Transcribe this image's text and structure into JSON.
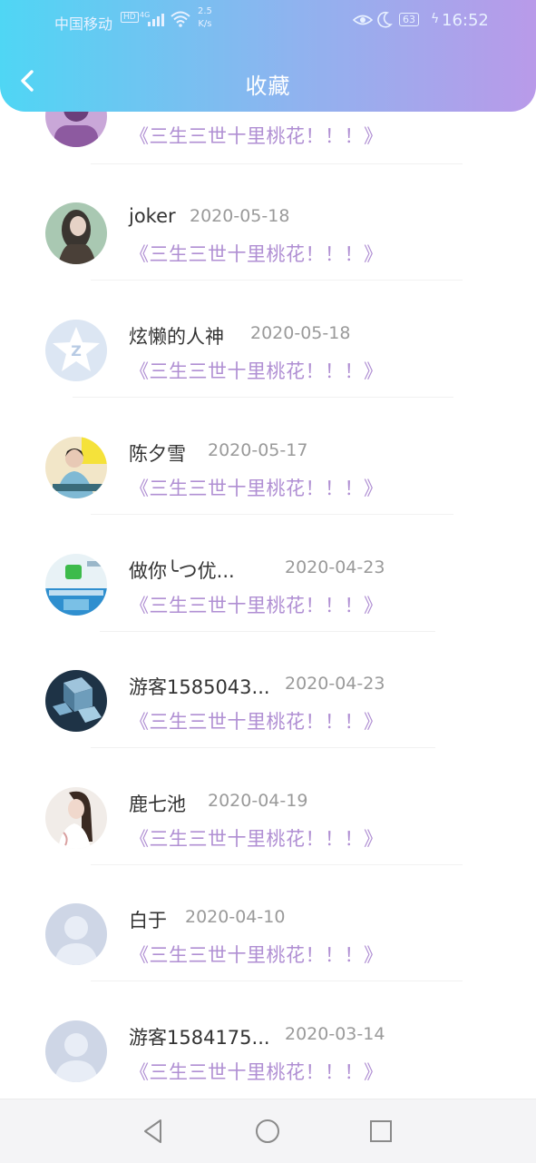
{
  "status_bar": {
    "carrier": "中国移动",
    "hd": "HD",
    "signal": "4G",
    "speed_value": "2.5",
    "speed_unit": "K/s",
    "battery": "63",
    "time": "16:52"
  },
  "header": {
    "title": "收藏",
    "back_icon": "chevron-left-icon"
  },
  "favorites": [
    {
      "name": "",
      "date": "",
      "content": "《三生三世十里桃花！！！》",
      "avatar": "purple-portrait"
    },
    {
      "name": "joker",
      "date": "2020-05-18",
      "content": "《三生三世十里桃花！！！》",
      "avatar": "long-hair-girl-photo"
    },
    {
      "name": "炫懒的人神",
      "date": "2020-05-18",
      "content": "《三生三世十里桃花！！！》",
      "avatar": "qzone-star-default"
    },
    {
      "name": "陈夕雪",
      "date": "2020-05-17",
      "content": "《三生三世十里桃花！！！》",
      "avatar": "costume-girl-photo"
    },
    {
      "name": "做你╰つ优...",
      "date": "2020-04-23",
      "content": "《三生三世十里桃花！！！》",
      "avatar": "wechat-ad-image"
    },
    {
      "name": "游客1585043...",
      "date": "2020-04-23",
      "content": "《三生三世十里桃花！！！》",
      "avatar": "blue-cubes-image"
    },
    {
      "name": "鹿七池",
      "date": "2020-04-19",
      "content": "《三生三世十里桃花！！！》",
      "avatar": "girl-portrait-photo"
    },
    {
      "name": "白于",
      "date": "2020-04-10",
      "content": "《三生三世十里桃花！！！》",
      "avatar": "default-user-avatar"
    },
    {
      "name": "游客1584175...",
      "date": "2020-03-14",
      "content": "《三生三世十里桃花！！！》",
      "avatar": "default-user-avatar"
    }
  ],
  "nav_bar": {
    "back": "triangle-back-icon",
    "home": "circle-home-icon",
    "recent": "square-recent-icon"
  },
  "colors": {
    "header_gradient_start": "#4fd6f4",
    "header_gradient_end": "#b99ae9",
    "content_text": "#b08fd3",
    "date_text": "#9a9a9a",
    "name_text": "#333333"
  }
}
